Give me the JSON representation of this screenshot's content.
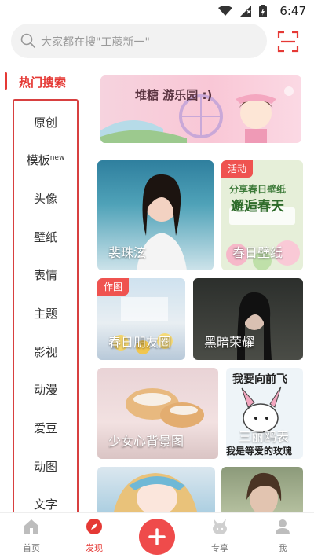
{
  "status_bar": {
    "time": "6:47"
  },
  "search": {
    "placeholder": "大家都在搜\"工藤新一\""
  },
  "sidebar": {
    "header": "热门搜索",
    "items": [
      {
        "label": "原创"
      },
      {
        "label": "模板",
        "sup": "new"
      },
      {
        "label": "头像"
      },
      {
        "label": "壁纸"
      },
      {
        "label": "表情"
      },
      {
        "label": "主题"
      },
      {
        "label": "影视"
      },
      {
        "label": "动漫"
      },
      {
        "label": "爱豆"
      },
      {
        "label": "动图"
      },
      {
        "label": "文字"
      }
    ]
  },
  "banner": {
    "title": "堆糖 游乐园 :)"
  },
  "cards": [
    {
      "label": "裴珠泫"
    },
    {
      "label": "春日壁纸",
      "badge": "活动",
      "headline": "分享春日壁纸",
      "subline": "邂逅春天"
    },
    {
      "label": "春日朋友圈",
      "badge": "作图"
    },
    {
      "label": "黑暗荣耀"
    },
    {
      "label": "少女心背景图"
    },
    {
      "label": "三丽鸥表",
      "top_text": "我要向前飞",
      "bottom_text": "我是等爱的玫瑰"
    },
    {
      "label": ""
    },
    {
      "label": ""
    }
  ],
  "bottom_nav": {
    "items": [
      {
        "label": "首页"
      },
      {
        "label": "发现"
      },
      {
        "label": "专享"
      },
      {
        "label": "我"
      }
    ]
  },
  "colors": {
    "accent": "#e53935"
  }
}
